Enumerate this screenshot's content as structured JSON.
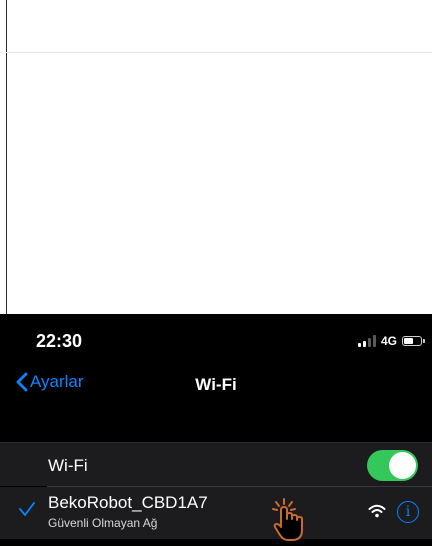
{
  "status_bar": {
    "time": "22:30",
    "network": "4G",
    "battery_level": 0.55
  },
  "nav": {
    "back_label": "Ayarlar",
    "title": "Wi-Fi"
  },
  "wifi_row": {
    "label": "Wi-Fi",
    "enabled": true
  },
  "network_row": {
    "name": "BekoRobot_CBD1A7",
    "security": "Güvenli Olmayan Ağ",
    "connected": true
  },
  "colors": {
    "accent": "#0a84ff",
    "toggle_on": "#34c759",
    "cell_background": "#1c1c1e",
    "screen_background": "#000000",
    "hand_pointer": "#c96a2e"
  },
  "icons": [
    "back-chevron-icon",
    "signal-bars-icon",
    "battery-icon",
    "checkmark-icon",
    "wifi-signal-icon",
    "info-icon",
    "tap-hand-icon"
  ]
}
